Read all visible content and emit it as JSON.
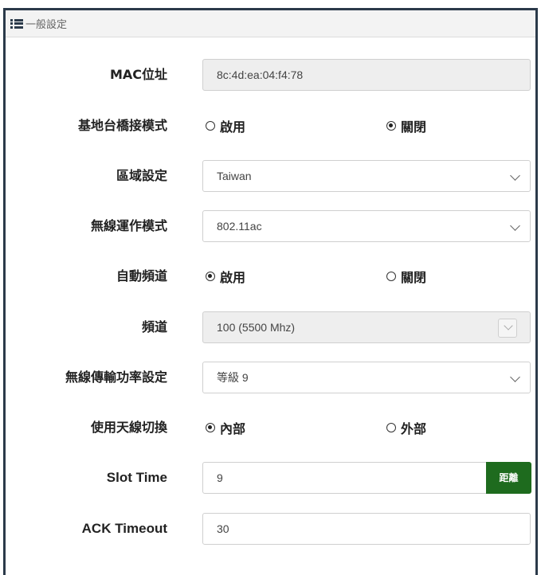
{
  "header": {
    "title": "一般設定",
    "icon": "list-icon"
  },
  "rows": {
    "mac": {
      "label": "MAC位址",
      "value": "8c:4d:ea:04:f4:78"
    },
    "bridge": {
      "label": "基地台橋接模式",
      "options": [
        "啟用",
        "關閉"
      ],
      "selected": "關閉"
    },
    "region": {
      "label": "區域設定",
      "value": "Taiwan"
    },
    "wmode": {
      "label": "無線運作模式",
      "value": "802.11ac"
    },
    "autochan": {
      "label": "自動頻道",
      "options": [
        "啟用",
        "關閉"
      ],
      "selected": "啟用"
    },
    "channel": {
      "label": "頻道",
      "value": "100 (5500 Mhz)"
    },
    "txpower": {
      "label": "無線傳輸功率設定",
      "value": "等級 9"
    },
    "antenna": {
      "label": "使用天線切換",
      "options": [
        "內部",
        "外部"
      ],
      "selected": "內部"
    },
    "slot": {
      "label": "Slot Time",
      "value": "9",
      "addon": "距離"
    },
    "ack": {
      "label": "ACK Timeout",
      "value": "30"
    }
  },
  "colors": {
    "addon": "#1e6b1e",
    "panel_border": "#2b3a4a"
  }
}
